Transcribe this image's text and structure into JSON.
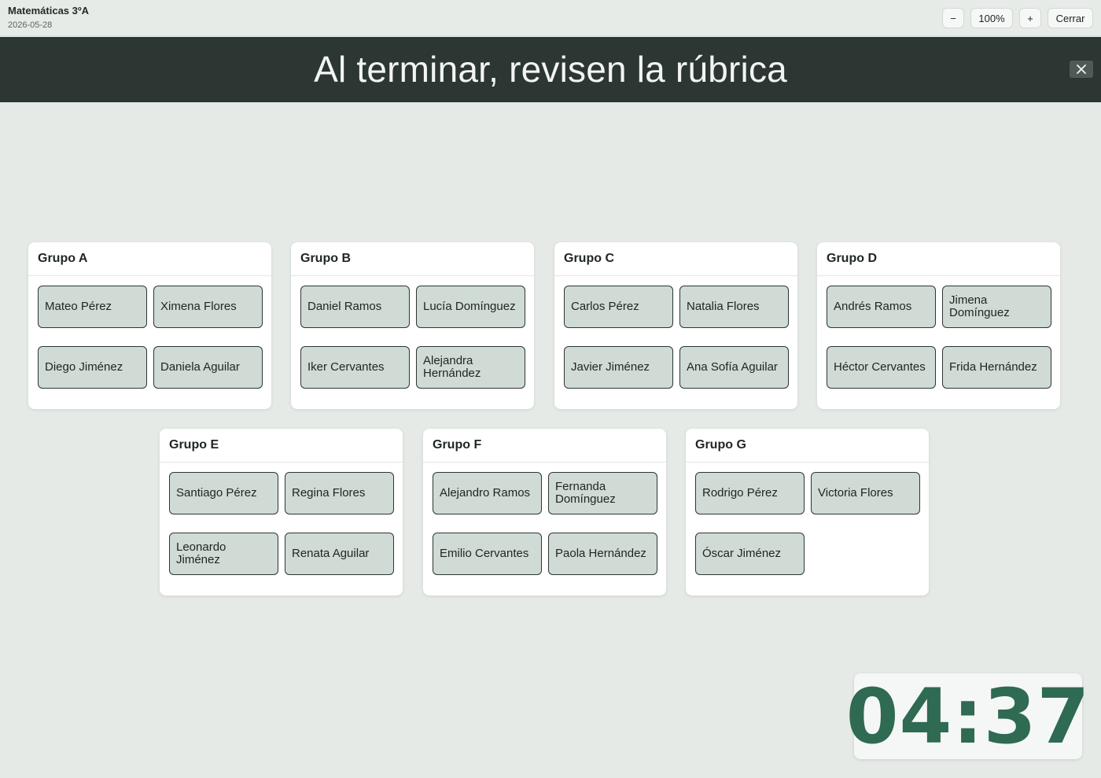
{
  "header": {
    "class_name": "Matemáticas 3ºA",
    "date": "2026-05-28",
    "zoom_out_label": "−",
    "zoom_level": "100%",
    "zoom_in_label": "+",
    "close_label": "Cerrar"
  },
  "banner": {
    "message": "Al terminar, revisen la rúbrica"
  },
  "groups": [
    {
      "title": "Grupo A",
      "students": [
        "Mateo Pérez",
        "Ximena Flores",
        "Diego Jiménez",
        "Daniela Aguilar"
      ]
    },
    {
      "title": "Grupo B",
      "students": [
        "Daniel Ramos",
        "Lucía Domínguez",
        "Iker Cervantes",
        "Alejandra Hernández"
      ]
    },
    {
      "title": "Grupo C",
      "students": [
        "Carlos Pérez",
        "Natalia Flores",
        "Javier Jiménez",
        "Ana Sofía Aguilar"
      ]
    },
    {
      "title": "Grupo D",
      "students": [
        "Andrés Ramos",
        "Jimena Domínguez",
        "Héctor Cervantes",
        "Frida Hernández"
      ]
    },
    {
      "title": "Grupo E",
      "students": [
        "Santiago Pérez",
        "Regina Flores",
        "Leonardo Jiménez",
        "Renata Aguilar"
      ]
    },
    {
      "title": "Grupo F",
      "students": [
        "Alejandro Ramos",
        "Fernanda Domínguez",
        "Emilio Cervantes",
        "Paola Hernández"
      ]
    },
    {
      "title": "Grupo G",
      "students": [
        "Rodrigo Pérez",
        "Victoria Flores",
        "Óscar Jiménez"
      ]
    }
  ],
  "timer": {
    "remaining": "04:37"
  },
  "colors": {
    "banner_bg": "#2c3734",
    "student_bg": "#cfdbd4",
    "timer_text": "#2f6a52"
  }
}
